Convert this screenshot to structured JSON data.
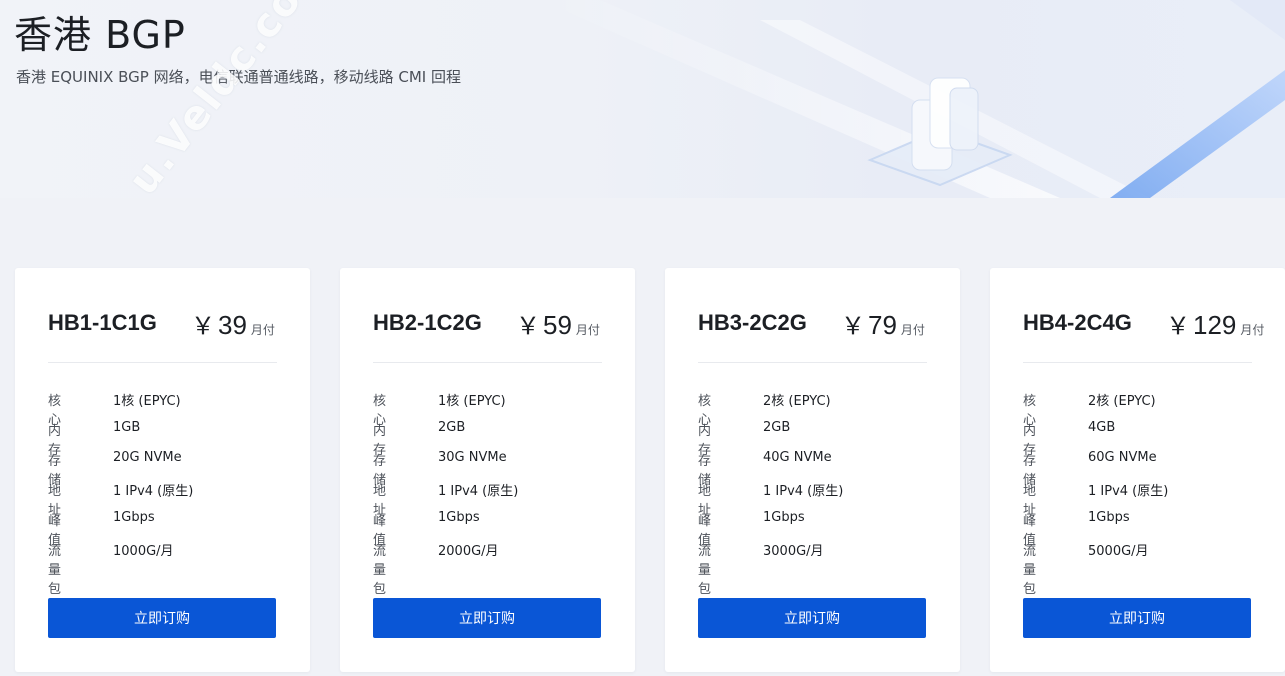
{
  "hero": {
    "title": "香港 BGP",
    "subtitle": "香港 EQUINIX BGP 网络，电信联通普通线路，移动线路 CMI 回程",
    "watermark": "u.Veldc.com"
  },
  "plans": [
    {
      "name": "HB1-1C1G",
      "currency": "￥",
      "price": "39",
      "unit": "月付",
      "specs": [
        {
          "label": "核心",
          "value": "1核 (EPYC)"
        },
        {
          "label": "内存",
          "value": "1GB"
        },
        {
          "label": "存储",
          "value": "20G NVMe"
        },
        {
          "label": "地址",
          "value": "1 IPv4 (原生)"
        },
        {
          "label": "峰值",
          "value": "1Gbps"
        },
        {
          "label": "流量包",
          "value": "1000G/月"
        }
      ],
      "button": "立即订购"
    },
    {
      "name": "HB2-1C2G",
      "currency": "￥",
      "price": "59",
      "unit": "月付",
      "specs": [
        {
          "label": "核心",
          "value": "1核 (EPYC)"
        },
        {
          "label": "内存",
          "value": "2GB"
        },
        {
          "label": "存储",
          "value": "30G NVMe"
        },
        {
          "label": "地址",
          "value": "1 IPv4 (原生)"
        },
        {
          "label": "峰值",
          "value": "1Gbps"
        },
        {
          "label": "流量包",
          "value": "2000G/月"
        }
      ],
      "button": "立即订购"
    },
    {
      "name": "HB3-2C2G",
      "currency": "￥",
      "price": "79",
      "unit": "月付",
      "specs": [
        {
          "label": "核心",
          "value": "2核 (EPYC)"
        },
        {
          "label": "内存",
          "value": "2GB"
        },
        {
          "label": "存储",
          "value": "40G NVMe"
        },
        {
          "label": "地址",
          "value": "1 IPv4 (原生)"
        },
        {
          "label": "峰值",
          "value": "1Gbps"
        },
        {
          "label": "流量包",
          "value": "3000G/月"
        }
      ],
      "button": "立即订购"
    },
    {
      "name": "HB4-2C4G",
      "currency": "￥",
      "price": "129",
      "unit": "月付",
      "specs": [
        {
          "label": "核心",
          "value": "2核 (EPYC)"
        },
        {
          "label": "内存",
          "value": "4GB"
        },
        {
          "label": "存储",
          "value": "60G NVMe"
        },
        {
          "label": "地址",
          "value": "1 IPv4 (原生)"
        },
        {
          "label": "峰值",
          "value": "1Gbps"
        },
        {
          "label": "流量包",
          "value": "5000G/月"
        }
      ],
      "button": "立即订购"
    }
  ],
  "colors": {
    "accent": "#0a56d6",
    "page_bg": "#f0f2f7",
    "card_bg": "#ffffff"
  }
}
